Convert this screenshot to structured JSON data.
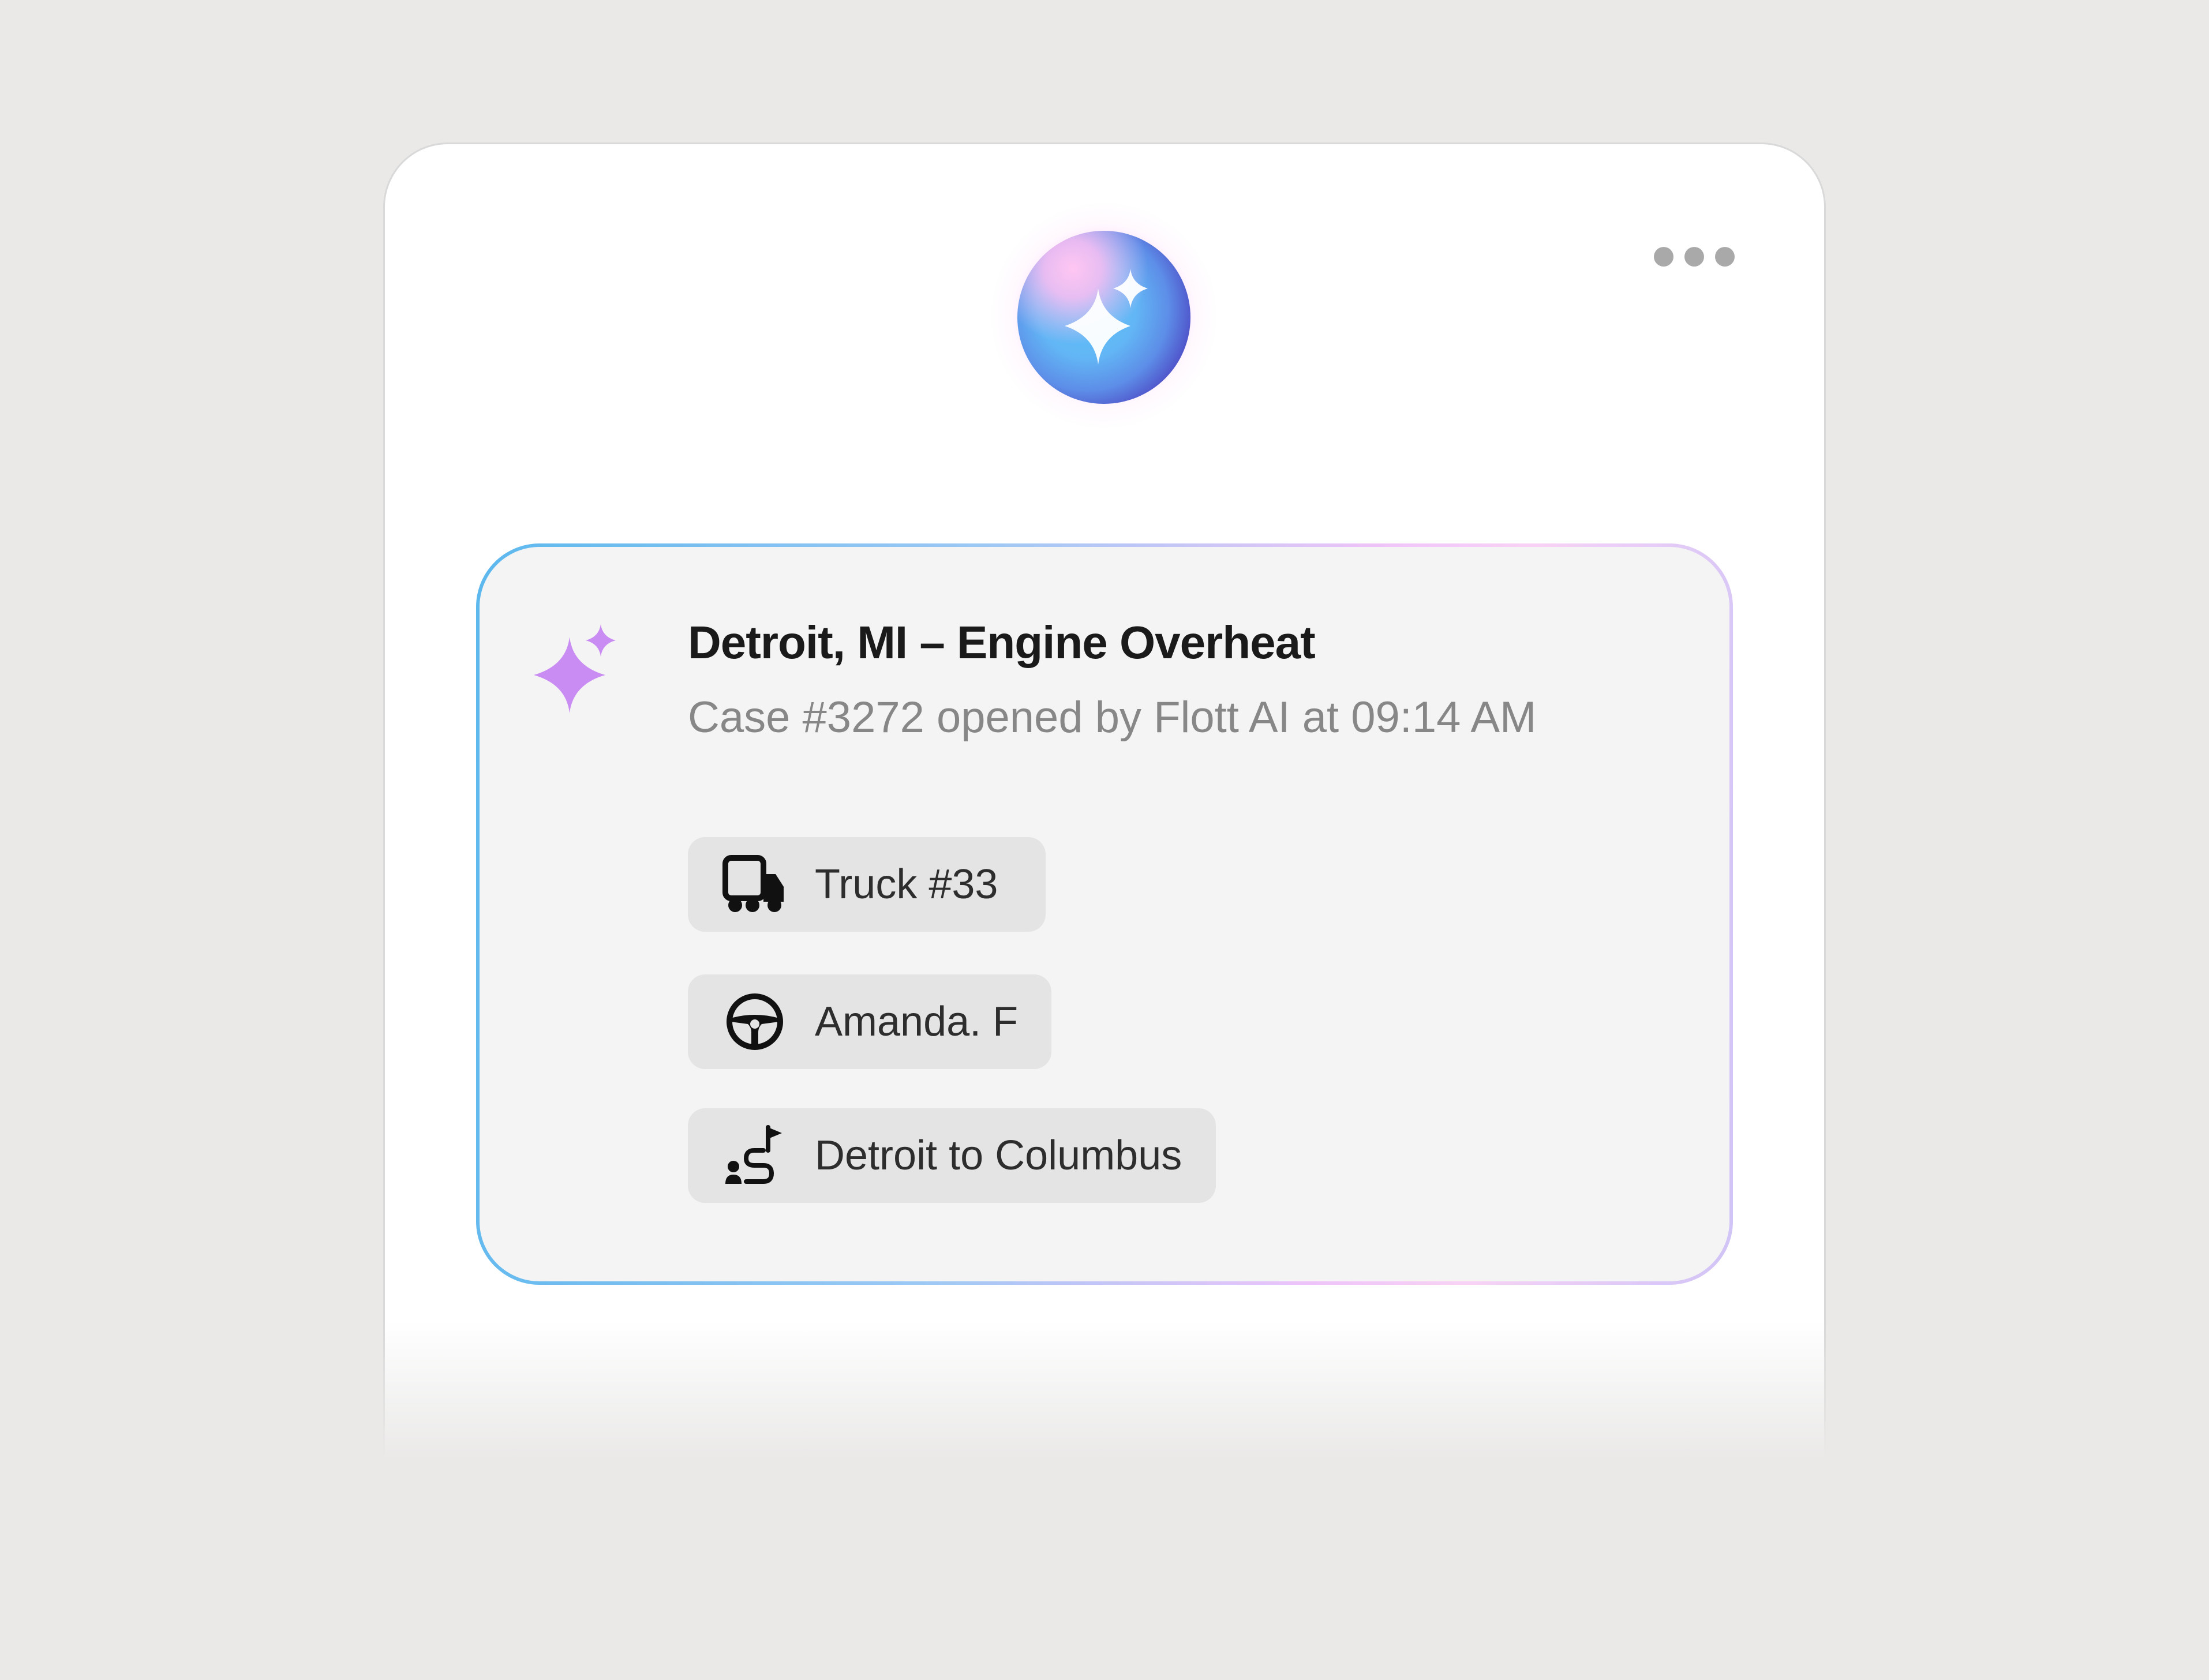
{
  "header": {
    "assistant_orb_icon": "sparkles-icon",
    "more_menu_icon": "more-horizontal-icon"
  },
  "case_card": {
    "icon": "sparkles-icon",
    "title": "Detroit, MI – Engine Overheat",
    "subtitle": "Case #3272 opened by Flott AI at 09:14 AM",
    "chips": [
      {
        "icon": "truck-icon",
        "label": "Truck #33"
      },
      {
        "icon": "steering-wheel-icon",
        "label": "Amanda. F"
      },
      {
        "icon": "route-icon",
        "label": "Detroit to Columbus"
      }
    ]
  },
  "colors": {
    "background": "#eae9e8",
    "card_background": "#f4f4f4",
    "chip_background": "#e4e4e4",
    "accent_blue": "#5cb8ee",
    "accent_pink": "#f8d2f6",
    "sparkle_purple": "#c98cf2"
  }
}
